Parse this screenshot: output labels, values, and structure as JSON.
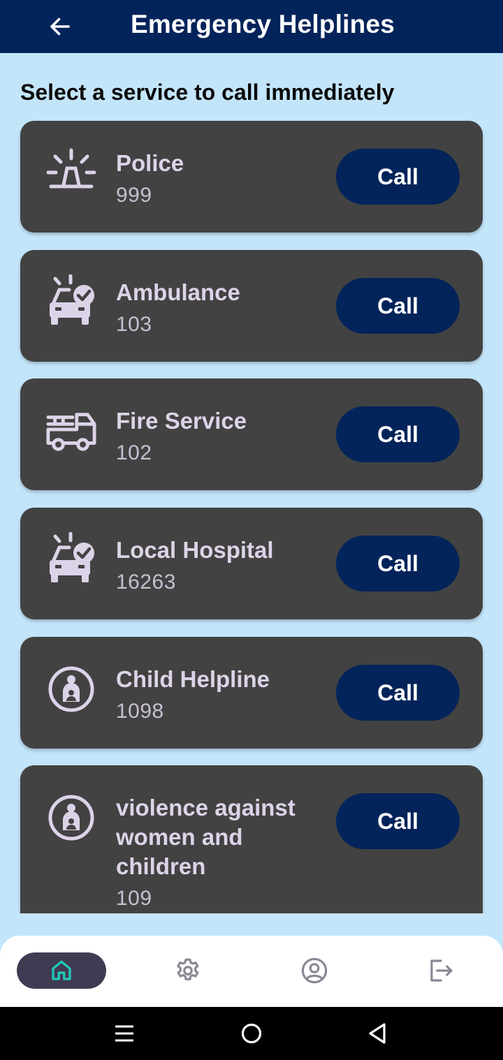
{
  "header": {
    "title": "Emergency Helplines",
    "back_icon": "arrow-left-icon"
  },
  "subtitle": "Select a service to call immediately",
  "services": [
    {
      "name": "Police",
      "number": "999",
      "icon": "police-siren-icon",
      "call_label": "Call"
    },
    {
      "name": "Ambulance",
      "number": "103",
      "icon": "ambulance-car-icon",
      "call_label": "Call"
    },
    {
      "name": "Fire Service",
      "number": "102",
      "icon": "fire-truck-icon",
      "call_label": "Call"
    },
    {
      "name": "Local Hospital",
      "number": "16263",
      "icon": "ambulance-car-icon",
      "call_label": "Call"
    },
    {
      "name": "Child Helpline",
      "number": "1098",
      "icon": "mother-child-icon",
      "call_label": "Call"
    },
    {
      "name": "violence against women and children",
      "number": "109",
      "icon": "mother-child-icon",
      "call_label": "Call"
    }
  ],
  "bottom_nav": [
    {
      "icon": "home-icon",
      "active": true
    },
    {
      "icon": "gear-icon",
      "active": false
    },
    {
      "icon": "profile-icon",
      "active": false
    },
    {
      "icon": "logout-icon",
      "active": false
    }
  ],
  "system_nav": [
    "recent-apps-icon",
    "home-circle-icon",
    "back-triangle-icon"
  ],
  "colors": {
    "appbar": "#03245a",
    "background": "#c3e5fa",
    "card": "#424242",
    "card_text": "#ddd3e8",
    "call_button": "#03245a",
    "active_nav_icon": "#1fc9b7"
  }
}
